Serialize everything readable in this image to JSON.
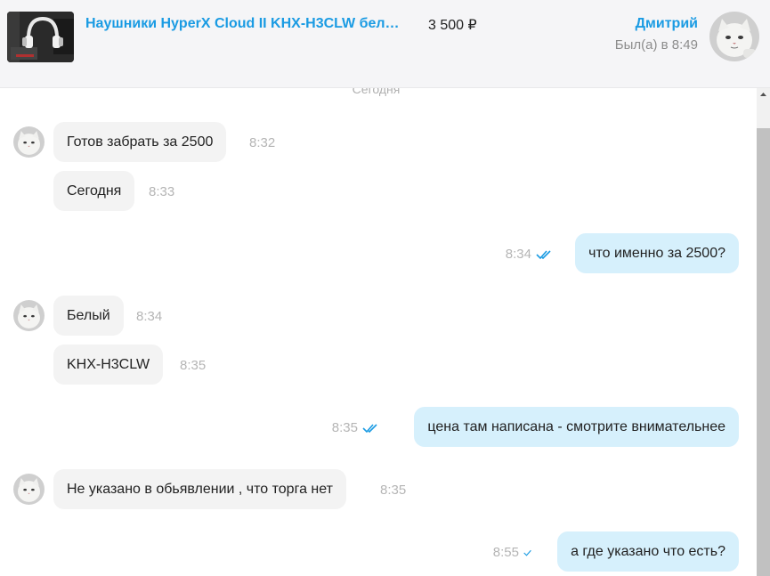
{
  "header": {
    "listing_title": "Наушники HyperX Cloud II KHX-H3CLW бел…",
    "price": "3 500 ₽",
    "seller_name": "Дмитрий",
    "seller_status": "Был(а) в 8:49",
    "thumbnail_icon": "headphones-photo",
    "avatar_icon": "cat-avatar"
  },
  "chat": {
    "date_divider": "Сегодня",
    "messages": [
      {
        "direction": "in",
        "text": "Готов забрать за 2500",
        "time": "8:32"
      },
      {
        "direction": "in",
        "text": "Сегодня",
        "time": "8:33"
      },
      {
        "direction": "out",
        "text": "что именно за 2500?",
        "time": "8:34",
        "status": "read"
      },
      {
        "direction": "in",
        "text": "Белый",
        "time": "8:34"
      },
      {
        "direction": "in",
        "text": "KHX-H3CLW",
        "time": "8:35"
      },
      {
        "direction": "out",
        "text": "цена там написана - смотрите внимательнее",
        "time": "8:35",
        "status": "read"
      },
      {
        "direction": "in",
        "text": "Не указано в обьявлении , что торга нет",
        "time": "8:35"
      },
      {
        "direction": "out",
        "text": "а где указано что есть?",
        "time": "8:55",
        "status": "delivered"
      }
    ]
  },
  "colors": {
    "accent": "#1a9be3",
    "incoming_bubble": "#f3f3f3",
    "outgoing_bubble": "#d6f0fc",
    "time_text": "#b5b5b5"
  }
}
